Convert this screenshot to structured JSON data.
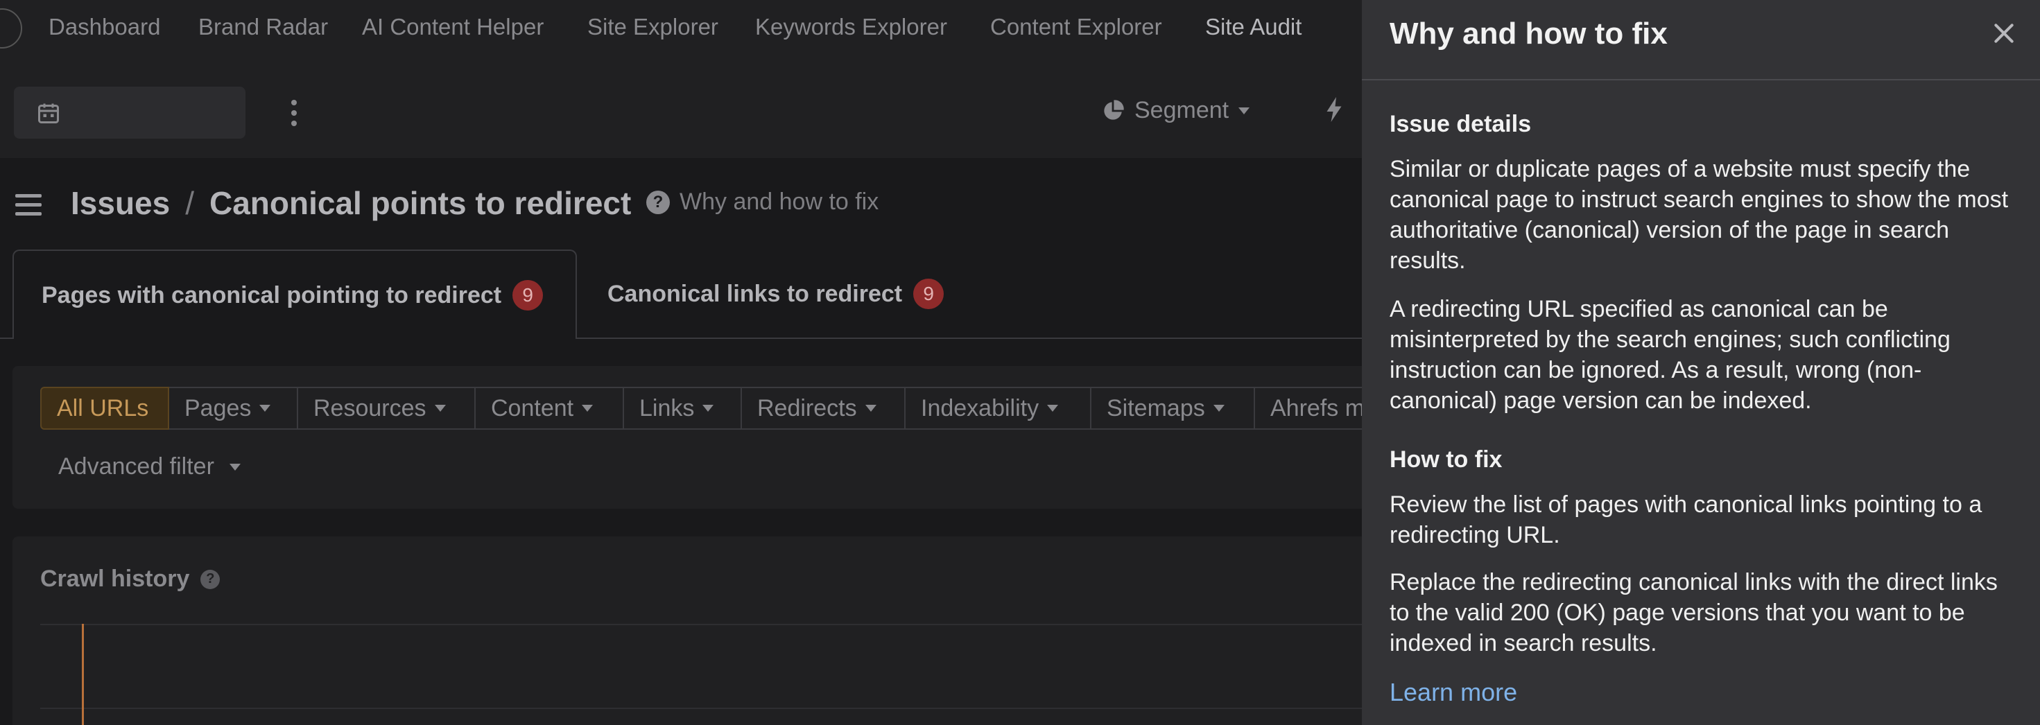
{
  "topnav": {
    "items": [
      {
        "label": "Dashboard"
      },
      {
        "label": "Brand Radar"
      },
      {
        "label": "AI Content Helper"
      },
      {
        "label": "Site Explorer"
      },
      {
        "label": "Keywords Explorer"
      },
      {
        "label": "Content Explorer"
      },
      {
        "label": "Site Audit"
      }
    ],
    "active": "Site Audit"
  },
  "toolbar": {
    "segment_label": "Segment"
  },
  "breadcrumb": {
    "root": "Issues",
    "separator": "/",
    "current": "Canonical points to redirect",
    "why_link": "Why and how to fix"
  },
  "tabs": [
    {
      "label": "Pages with canonical pointing to redirect",
      "count": "9"
    },
    {
      "label": "Canonical links to redirect",
      "count": "9"
    }
  ],
  "filters": {
    "buttons": [
      {
        "label": "All URLs"
      },
      {
        "label": "Pages"
      },
      {
        "label": "Resources"
      },
      {
        "label": "Content"
      },
      {
        "label": "Links"
      },
      {
        "label": "Redirects"
      },
      {
        "label": "Indexability"
      },
      {
        "label": "Sitemaps"
      },
      {
        "label": "Ahrefs m"
      }
    ],
    "advanced": "Advanced filter"
  },
  "crawl_history": {
    "title": "Crawl history"
  },
  "drawer": {
    "title": "Why and how to fix",
    "issue_heading": "Issue details",
    "issue_p1": "Similar or duplicate pages of a website must specify the canonical page to instruct search engines to show the most authoritative (canonical) version of the page in search results.",
    "issue_p2": "A redirecting URL specified as canonical can be misinterpreted by the search engines; such conflicting instruction can be ignored. As a result, wrong (non-canonical) page version can be indexed.",
    "fix_heading": "How to fix",
    "fix_p1": "Review the list of pages with canonical links pointing to a redirecting URL.",
    "fix_p2": "Replace the redirecting canonical links with the direct links to the valid 200 (OK) page versions that you want to be indexed in search results.",
    "learn_more": "Learn more"
  },
  "colors": {
    "drawer_bg": "#333336",
    "link": "#7fb2e8",
    "badge": "#8e2a2a",
    "active_filter": "#3d2e16"
  }
}
